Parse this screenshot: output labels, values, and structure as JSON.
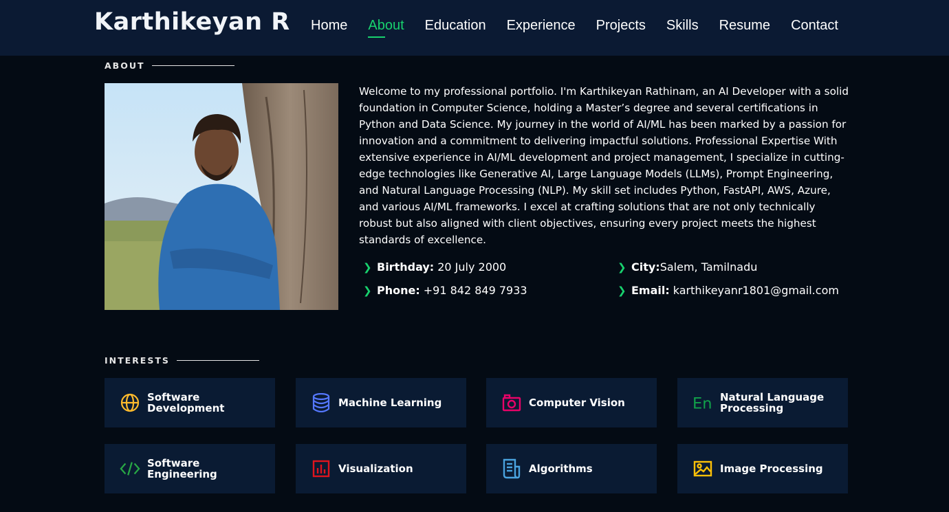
{
  "header": {
    "logo": "Karthikeyan R",
    "nav": [
      "Home",
      "About",
      "Education",
      "Experience",
      "Projects",
      "Skills",
      "Resume",
      "Contact"
    ],
    "active_nav": "About"
  },
  "about": {
    "title": "ABOUT",
    "paragraph": "Welcome to my professional portfolio. I'm Karthikeyan Rathinam, an AI Developer with a solid foundation in Computer Science, holding a Master’s degree and several certifications in Python and Data Science. My journey in the world of AI/ML has been marked by a passion for innovation and a commitment to delivering impactful solutions. Professional Expertise With extensive experience in AI/ML development and project management, I specialize in cutting-edge technologies like Generative AI, Large Language Models (LLMs), Prompt Engineering, and Natural Language Processing (NLP). My skill set includes Python, FastAPI, AWS, Azure, and various AI/ML frameworks. I excel at crafting solutions that are not only technically robust but also aligned with client objectives, ensuring every project meets the highest standards of excellence.",
    "details": {
      "birthday_label": "Birthday:",
      "birthday": "20 July 2000",
      "city_label": "City:",
      "city": "Salem, Tamilnadu",
      "phone_label": "Phone:",
      "phone": "+91 842 849 7933",
      "email_label": "Email:",
      "email": "karthikeyanr1801@gmail.com"
    }
  },
  "interests": {
    "title": "INTERESTS",
    "items": [
      {
        "label_1": "Software",
        "label_2": "Development",
        "icon": "globe-icon",
        "color": "#ffbb2c"
      },
      {
        "label_1": "Machine Learning",
        "label_2": "",
        "icon": "database-icon",
        "color": "#5578ff"
      },
      {
        "label_1": "Computer Vision",
        "label_2": "",
        "icon": "camera-icon",
        "color": "#e80368"
      },
      {
        "label_1": "Natural Language",
        "label_2": "Processing",
        "icon": "language-icon",
        "color": "#11a14a"
      },
      {
        "label_1": "Software",
        "label_2": "Engineering",
        "icon": "code-icon",
        "color": "#28a745"
      },
      {
        "label_1": "Visualization",
        "label_2": "",
        "icon": "bar-chart-icon",
        "color": "#e0141e"
      },
      {
        "label_1": "Algorithms",
        "label_2": "",
        "icon": "document-icon",
        "color": "#4aa3df"
      },
      {
        "label_1": "Image Processing",
        "label_2": "",
        "icon": "image-icon",
        "color": "#ffc107"
      }
    ]
  }
}
